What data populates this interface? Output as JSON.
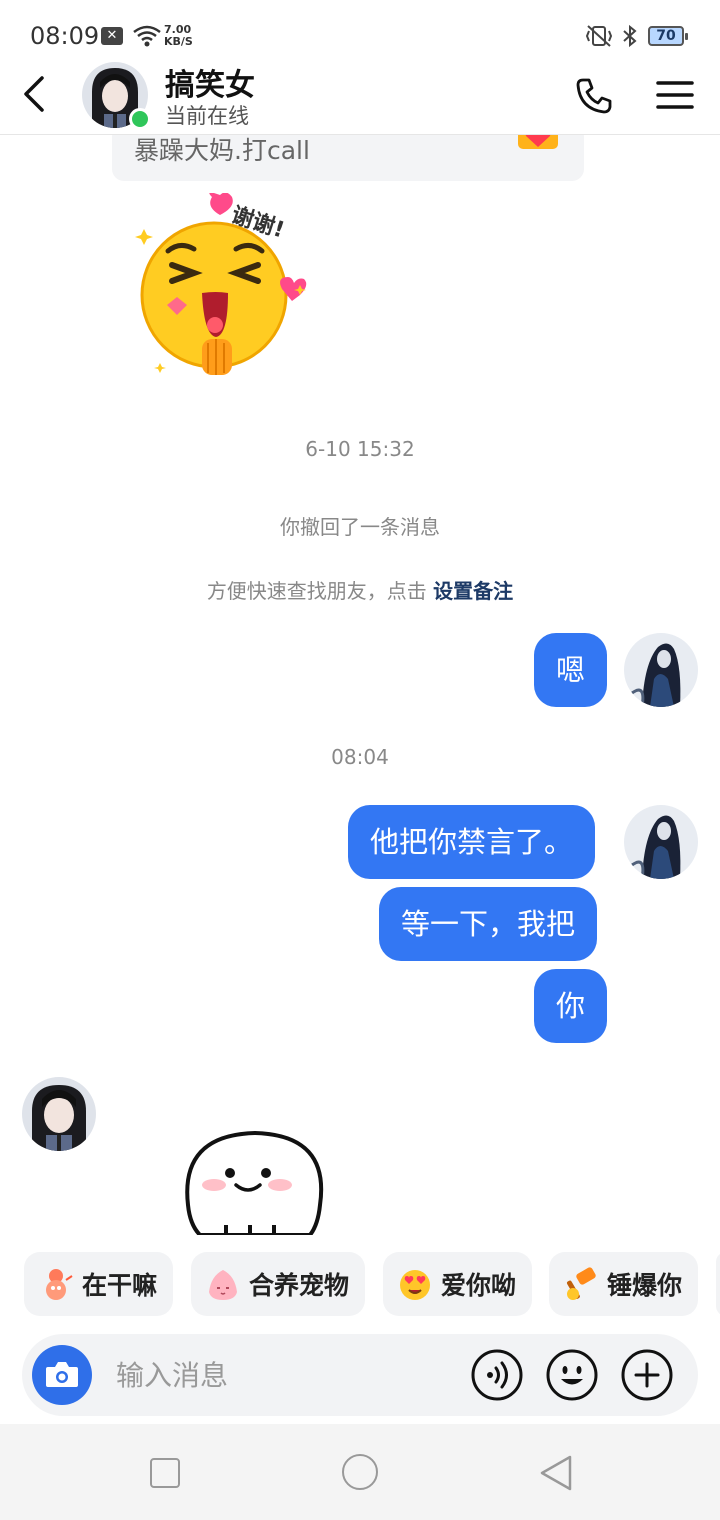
{
  "status_bar": {
    "time": "08:09",
    "x_badge": "✕",
    "net_speed_value": "7.00",
    "net_speed_unit": "KB/S",
    "battery": "70"
  },
  "header": {
    "contact_name": "搞笑女",
    "contact_status": "当前在线"
  },
  "messages": {
    "gift_text": "暴躁大妈.打call",
    "sticker_caption": "谢谢!",
    "timestamp_1": "6-10 15:32",
    "recall_notice": "你撤回了一条消息",
    "remark_hint": "方便快速查找朋友，点击",
    "remark_link": "设置备注",
    "bubble_1": "嗯",
    "timestamp_2": "08:04",
    "bubble_2": "他把你禁言了。",
    "bubble_3": "等一下，我把",
    "bubble_4": "你"
  },
  "quick_replies": [
    {
      "label": "在干嘛",
      "icon": "doll-emoji-icon"
    },
    {
      "label": "合养宠物",
      "icon": "pet-egg-icon"
    },
    {
      "label": "爱你呦",
      "icon": "heart-eyes-emoji-icon"
    },
    {
      "label": "锤爆你",
      "icon": "hammer-emoji-icon"
    }
  ],
  "input": {
    "placeholder": "输入消息"
  },
  "colors": {
    "bubble_blue": "#3377f3",
    "online_green": "#2fc65a",
    "camera_blue": "#2f6fe9",
    "remark_link": "#1d3a66"
  }
}
